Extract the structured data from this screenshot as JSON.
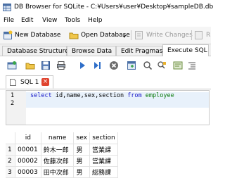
{
  "window": {
    "title": "DB Browser for SQLite - C:¥Users¥user¥Desktop¥sampleDB.db"
  },
  "menu": {
    "items": [
      "File",
      "Edit",
      "View",
      "Tools",
      "Help"
    ]
  },
  "toolbar": {
    "new_database": "New Database",
    "open_database": "Open Database",
    "write_changes": "Write Changes",
    "revert_partial": "R"
  },
  "tabs": [
    "Database Structure",
    "Browse Data",
    "Edit Pragmas",
    "Execute SQL"
  ],
  "active_tab": "Execute SQL",
  "sql_tab": {
    "label": "SQL 1",
    "close": "×"
  },
  "editor": {
    "line_numbers": [
      "1",
      "2"
    ],
    "tokens": {
      "select": "select",
      "columns": " id,name,sex,section ",
      "from": "from",
      "space": " ",
      "table": "employee"
    }
  },
  "results": {
    "columns": [
      "id",
      "name",
      "sex",
      "section"
    ],
    "rows": [
      {
        "n": "1",
        "id": "00001",
        "name": "鈴木一郎",
        "sex": "男",
        "section": "営業課"
      },
      {
        "n": "2",
        "id": "00002",
        "name": "佐藤次郎",
        "sex": "男",
        "section": "営業課"
      },
      {
        "n": "3",
        "id": "00003",
        "name": "田中次郎",
        "sex": "男",
        "section": "総務課"
      }
    ]
  },
  "colors": {
    "keyword": "#1616c8",
    "table": "#0a7a0a",
    "close": "#e0442f"
  }
}
